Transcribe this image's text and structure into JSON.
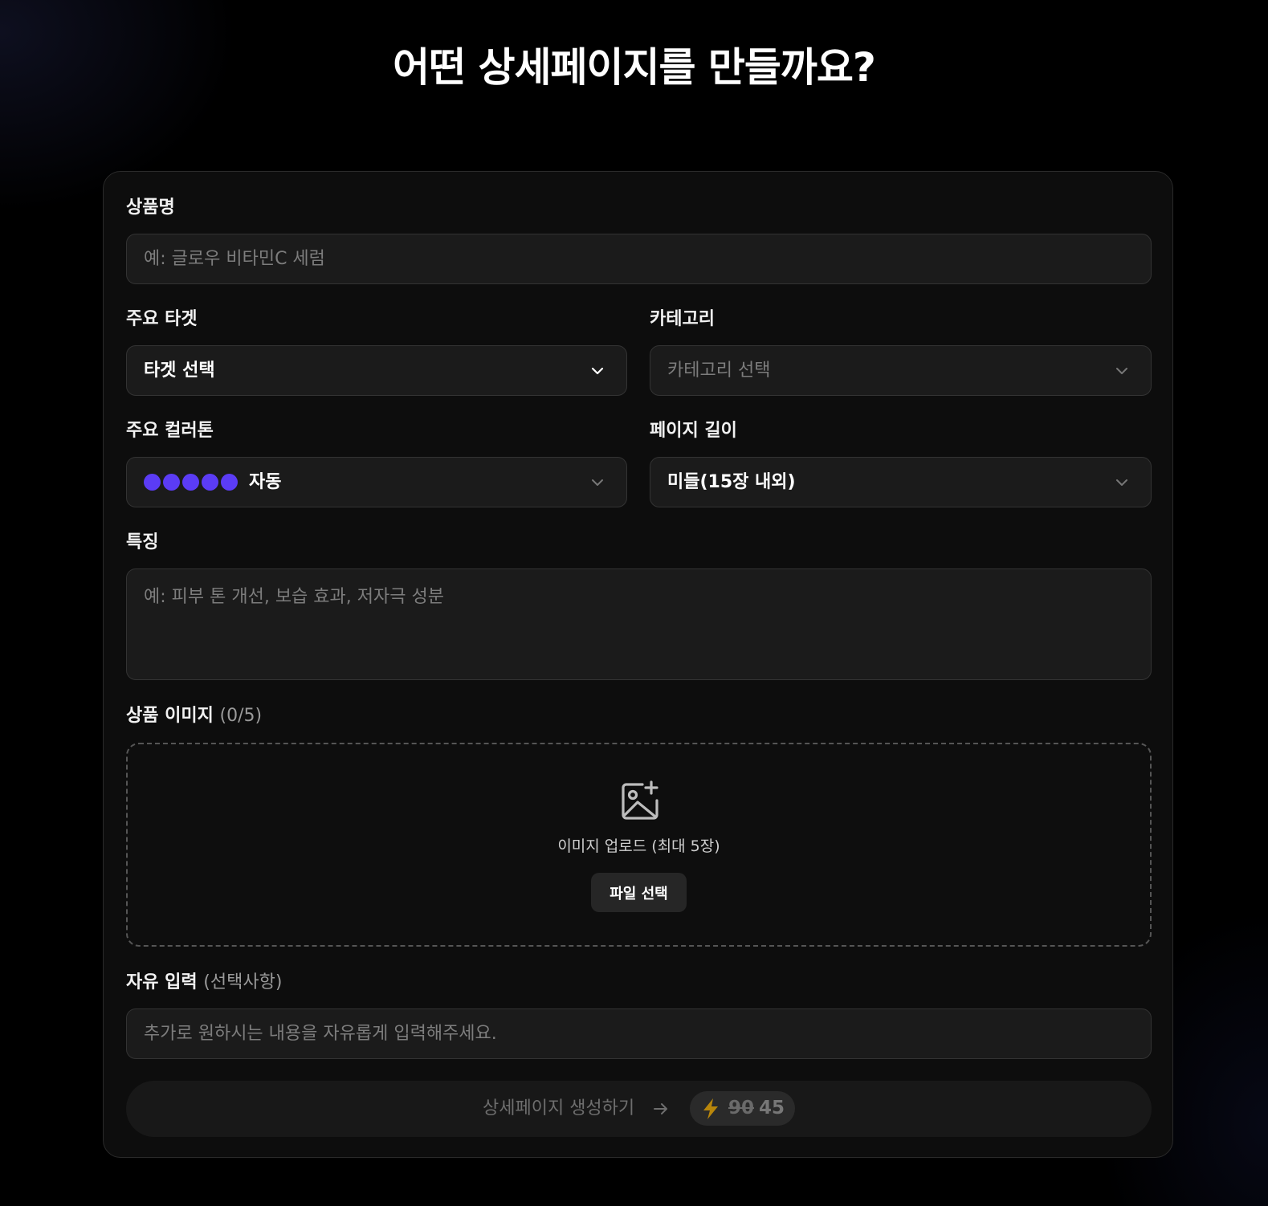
{
  "page": {
    "title": "어떤 상세페이지를 만들까요?"
  },
  "form": {
    "product_name": {
      "label": "상품명",
      "placeholder": "예: 글로우 비타민C 세럼",
      "value": ""
    },
    "target": {
      "label": "주요 타겟",
      "selected": "타겟 선택"
    },
    "category": {
      "label": "카테고리",
      "selected": "카테고리 선택"
    },
    "color_tone": {
      "label": "주요 컬러톤",
      "selected": "자동",
      "swatch_colors": [
        "#5b3cf5",
        "#5b3cf5",
        "#5b3cf5",
        "#5b3cf5",
        "#5b3cf5"
      ]
    },
    "page_length": {
      "label": "페이지 길이",
      "selected": "미들(15장 내외)"
    },
    "features": {
      "label": "특징",
      "placeholder": "예: 피부 톤 개선, 보습 효과, 저자극 성분",
      "value": ""
    },
    "images": {
      "label": "상품 이미지",
      "count": "(0/5)",
      "upload_text": "이미지 업로드 (최대 5장)",
      "button_label": "파일 선택"
    },
    "free_input": {
      "label": "자유 입력",
      "optional": "(선택사항)",
      "placeholder": "추가로 원하시는 내용을 자유롭게 입력해주세요.",
      "value": ""
    },
    "submit": {
      "label": "상세페이지 생성하기",
      "old_price": "90",
      "new_price": "45"
    }
  },
  "colors": {
    "accent": "#5b3cf5",
    "bolt": "#b8860b"
  }
}
